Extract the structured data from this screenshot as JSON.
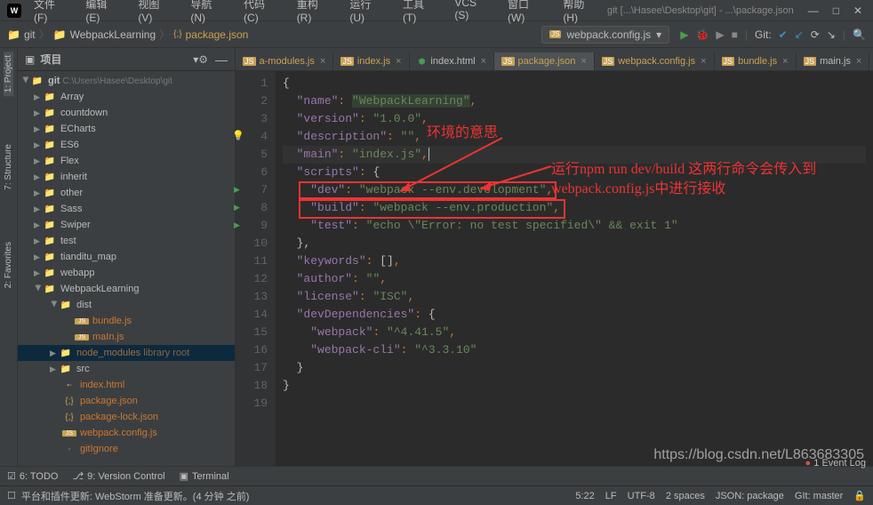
{
  "window": {
    "title": "git [...\\Hasee\\Desktop\\git] - ...\\package.json"
  },
  "menu": {
    "file": "文件 (F)",
    "edit": "编辑 (E)",
    "view": "视图 (V)",
    "nav": "导航 (N)",
    "code": "代码 (C)",
    "refactor": "重构 (R)",
    "run": "运行 (U)",
    "tools": "工具 (T)",
    "vcs": "VCS (S)",
    "window": "窗口 (W)",
    "help": "帮助 (H)"
  },
  "breadcrumb": {
    "root": "git",
    "folder": "WebpackLearning",
    "file": "package.json"
  },
  "run_config": {
    "label": "webpack.config.js",
    "dropdown": "▾"
  },
  "git_widget": {
    "label": "Git:",
    "check": "✔",
    "down": "↙",
    "up": "↗",
    "history": "⟳",
    "more": "↘"
  },
  "sidebar": {
    "project": "1: Project",
    "structure": "7: Structure",
    "favorites": "2: Favorites"
  },
  "panel": {
    "title": "项目",
    "dropdown": "▾"
  },
  "tree": {
    "root": "git",
    "root_path": "C:\\Users\\Hasee\\Desktop\\git",
    "items": [
      "Array",
      "countdown",
      "ECharts",
      "ES6",
      "Flex",
      "inherit",
      "other",
      "Sass",
      "Swiper",
      "test",
      "tianditu_map",
      "webapp"
    ],
    "wl": "WebpackLearning",
    "dist": "dist",
    "bundle": "bundle.js",
    "mainjs": "maIn.js",
    "node_modules": "node_modules",
    "lib_root": "library root",
    "src": "src",
    "indexhtml": "index.html",
    "pkg": "package.json",
    "pkglock": "package-lock.json",
    "wpconf": "webpack.config.js",
    "gitignore": "gitIgnore"
  },
  "tabs": [
    {
      "name": "a-modules.js",
      "type": "js",
      "orange": true
    },
    {
      "name": "index.js",
      "type": "js",
      "orange": true
    },
    {
      "name": "index.html",
      "type": "html",
      "orange": false
    },
    {
      "name": "package.json",
      "type": "js",
      "orange": true,
      "active": true
    },
    {
      "name": "webpack.config.js",
      "type": "js",
      "orange": true
    },
    {
      "name": "bundle.js",
      "type": "js",
      "orange": true
    },
    {
      "name": "main.js",
      "type": "js",
      "orange": false
    }
  ],
  "code": {
    "l1_open": "{",
    "l2_key": "\"name\"",
    "l2_val": "\"WebpackLearning\"",
    "l3_key": "\"version\"",
    "l3_val": "\"1.0.0\"",
    "l4_key": "\"description\"",
    "l4_val": "\"\"",
    "l5_key": "\"main\"",
    "l5_val": "\"index.js\"",
    "l6_key": "\"scripts\"",
    "l7_key": "\"dev\"",
    "l7_val": "\"webpack --env.development\"",
    "l8_key": "\"build\"",
    "l8_val": "\"webpack --env.production\"",
    "l9_key": "\"test\"",
    "l9_val": "\"echo \\\"Error: no test specified\\\" && exit 1\"",
    "l10_close": "},",
    "l11_key": "\"keywords\"",
    "l11_val": "[]",
    "l12_key": "\"author\"",
    "l12_val": "\"\"",
    "l13_key": "\"license\"",
    "l13_val": "\"ISC\"",
    "l14_key": "\"devDependencies\"",
    "l15_key": "\"webpack\"",
    "l15_val": "\"^4.41.5\"",
    "l16_key": "\"webpack-cli\"",
    "l16_val": "\"^3.3.10\"",
    "l17_close": "}",
    "l18_close2": "}"
  },
  "annotations": {
    "a1": "环境的意思",
    "a2_l1": "运行npm run dev/build 这两行命令会传入到",
    "a2_l2": "webpack.config.js中进行接收"
  },
  "bottom": {
    "todo": "6: TODO",
    "vc": "9: Version Control",
    "terminal": "Terminal",
    "event_log": "Event Log",
    "event_count": "1"
  },
  "status": {
    "msg": "平台和插件更新: WebStorm 准备更新。(4 分钟 之前)",
    "pos": "5:22",
    "lf": "LF",
    "enc": "UTF-8",
    "spaces": "2 spaces",
    "schema": "JSON: package",
    "git": "GIt: master",
    "lock": "🔒"
  },
  "watermark": "https://blog.csdn.net/L863683305"
}
